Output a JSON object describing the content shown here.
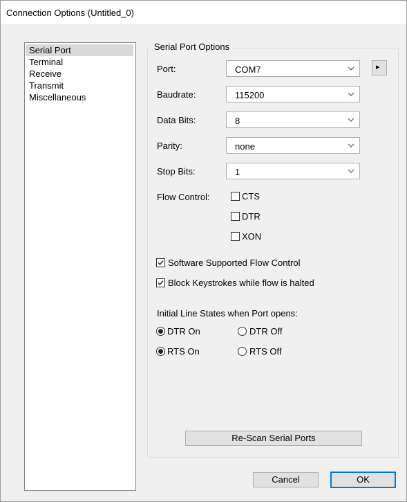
{
  "window": {
    "title": "Connection Options (Untitled_0)"
  },
  "categories": [
    "Serial Port",
    "Terminal",
    "Receive",
    "Transmit",
    "Miscellaneous"
  ],
  "group": {
    "title": "Serial Port Options"
  },
  "fields": {
    "port": {
      "label": "Port:",
      "value": "COM7"
    },
    "baudrate": {
      "label": "Baudrate:",
      "value": "115200"
    },
    "data_bits": {
      "label": "Data Bits:",
      "value": "8"
    },
    "parity": {
      "label": "Parity:",
      "value": "none"
    },
    "stop_bits": {
      "label": "Stop Bits:",
      "value": "1"
    }
  },
  "port_side_button": {
    "icon": "triangle-right-icon",
    "glyph": "▸"
  },
  "flow_control": {
    "label": "Flow Control:",
    "options": [
      {
        "label": "CTS",
        "checked": false
      },
      {
        "label": "DTR",
        "checked": false
      },
      {
        "label": "XON",
        "checked": false
      }
    ]
  },
  "software_flow": {
    "label": "Software Supported Flow Control",
    "checked": true
  },
  "block_keystrokes": {
    "label": "Block Keystrokes while flow is halted",
    "checked": true
  },
  "line_states": {
    "label": "Initial Line States when Port opens:",
    "dtr_on": {
      "label": "DTR On",
      "selected": true
    },
    "dtr_off": {
      "label": "DTR Off",
      "selected": false
    },
    "rts_on": {
      "label": "RTS On",
      "selected": true
    },
    "rts_off": {
      "label": "RTS Off",
      "selected": false
    }
  },
  "buttons": {
    "rescan": "Re-Scan Serial Ports",
    "cancel": "Cancel",
    "ok": "OK"
  },
  "colors": {
    "accent": "#0078d7",
    "selection": "#d9d9d9"
  }
}
